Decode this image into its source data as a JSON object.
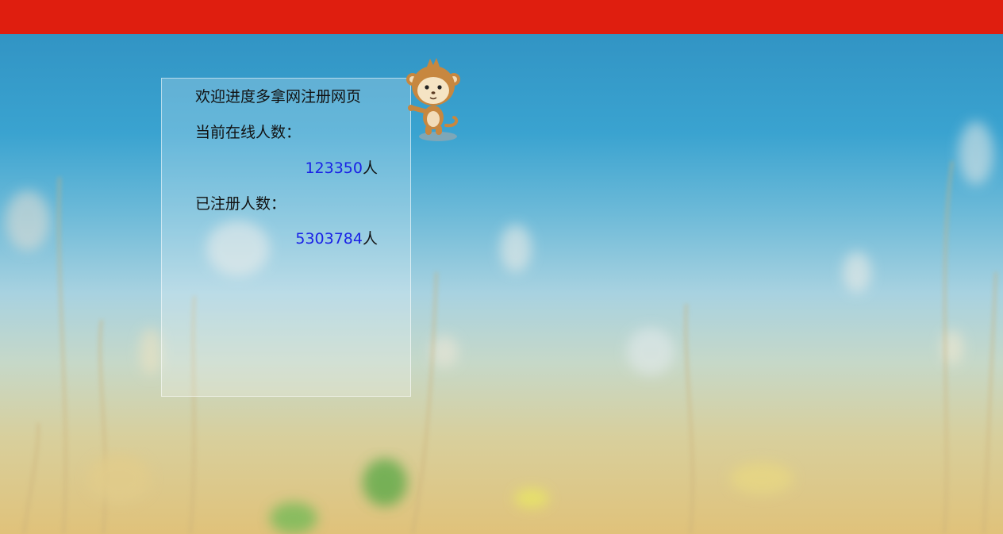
{
  "header": {
    "bar_color": "#df1e0f"
  },
  "panel": {
    "welcome_text": "欢迎进度多拿网注册网页",
    "online": {
      "label": "当前在线人数：",
      "value": "123350",
      "unit": "人"
    },
    "registered": {
      "label": "已注册人数：",
      "value": "5303784",
      "unit": "人"
    },
    "number_color": "#1a22e6"
  },
  "mascot": {
    "icon": "monkey-mascot-icon"
  }
}
